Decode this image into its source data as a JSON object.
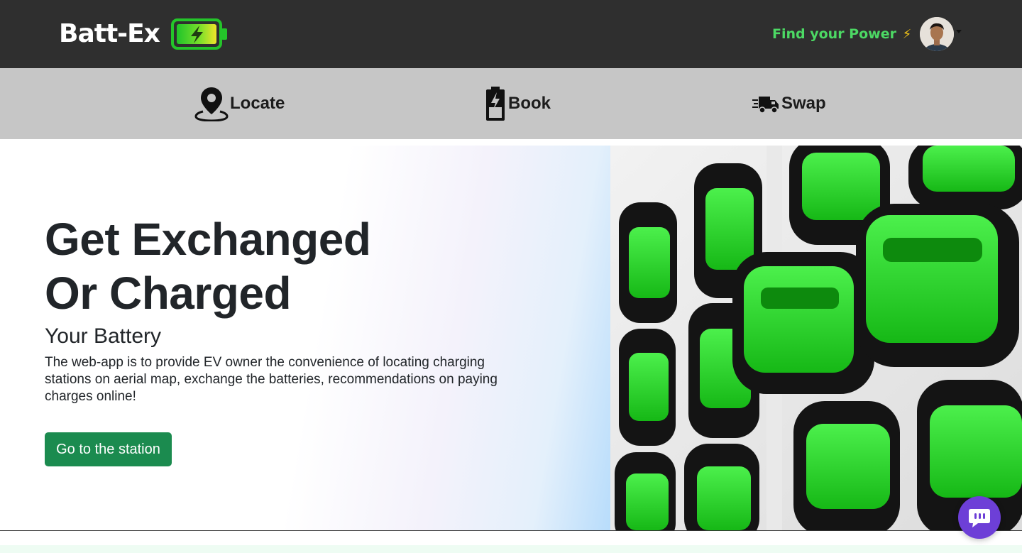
{
  "header": {
    "brand": "Batt-Ex",
    "tagline": "Find your Power",
    "tagline_icon": "⚡",
    "colors": {
      "background": "#2f2f2f",
      "tagline": "#4cd964"
    }
  },
  "nav": {
    "items": [
      {
        "label": "Locate",
        "icon": "map-pin-icon"
      },
      {
        "label": "Book",
        "icon": "battery-icon"
      },
      {
        "label": "Swap",
        "icon": "delivery-truck-icon"
      }
    ],
    "colors": {
      "background": "#c6c6c6"
    }
  },
  "hero": {
    "headline_line1": "Get Exchanged",
    "headline_line2": "Or Charged",
    "subheading": "Your Battery",
    "description": "The web-app is to provide EV owner the convenience of locating charging stations on aerial map, exchange the batteries, recommendations on paying charges online!",
    "cta_label": "Go to the station",
    "colors": {
      "cta": "#1b8b4f",
      "battery_green": "#2fd62f"
    }
  },
  "chat": {
    "icon": "chat-icon",
    "color": "#6d3fd7"
  }
}
